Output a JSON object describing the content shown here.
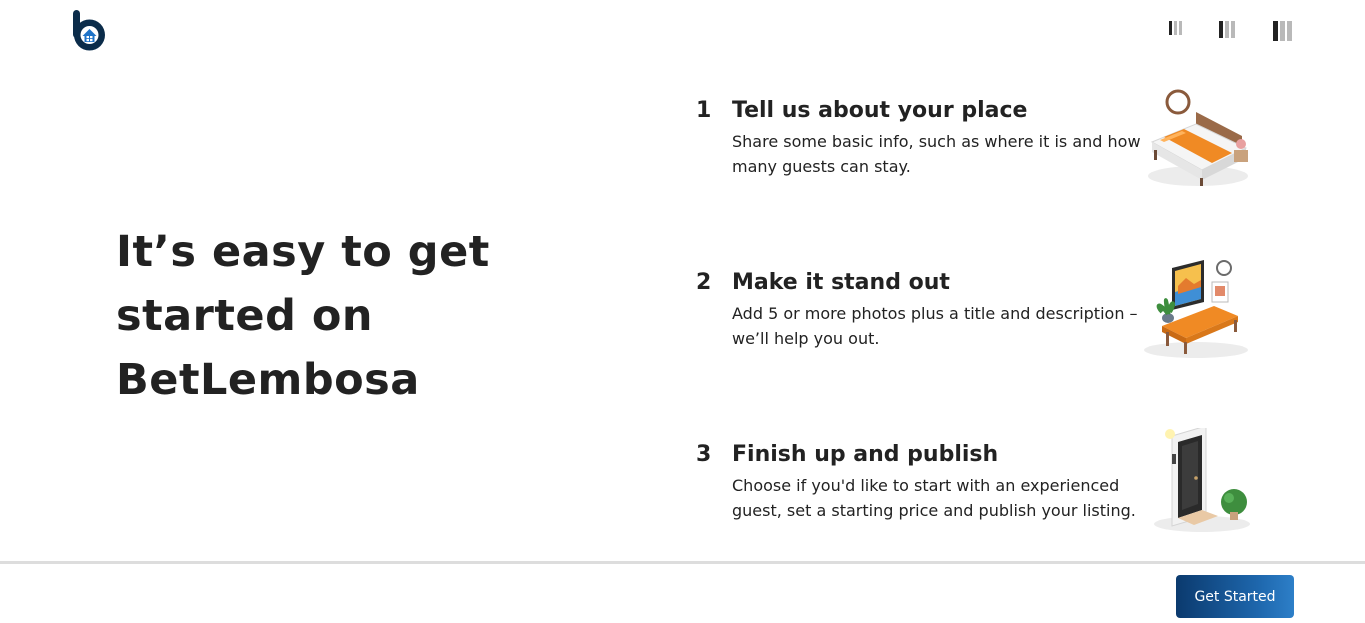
{
  "brand": {
    "name": "BetLembosa",
    "logo_icon": "house-b-logo",
    "accent": "#0b3a6e"
  },
  "header": {
    "step_indicators": [
      {
        "icon": "bars-small-icon"
      },
      {
        "icon": "bars-medium-icon"
      },
      {
        "icon": "bars-large-icon"
      }
    ]
  },
  "hero": {
    "title": "It’s easy to get started on BetLembosa"
  },
  "steps": [
    {
      "number": "1",
      "title": "Tell us about your place",
      "description": "Share some basic info, such as where it is and how many guests can stay.",
      "icon": "bed-illustration-icon"
    },
    {
      "number": "2",
      "title": "Make it stand out",
      "description": "Add 5 or more photos plus a title and description – we’ll help you out.",
      "icon": "living-room-illustration-icon"
    },
    {
      "number": "3",
      "title": "Finish up and publish",
      "description": "Choose if you'd like to start with an experienced guest, set a starting price and publish your listing.",
      "icon": "front-door-illustration-icon"
    }
  ],
  "footer": {
    "get_started_label": "Get Started",
    "button_color": "#0b3a6e"
  }
}
